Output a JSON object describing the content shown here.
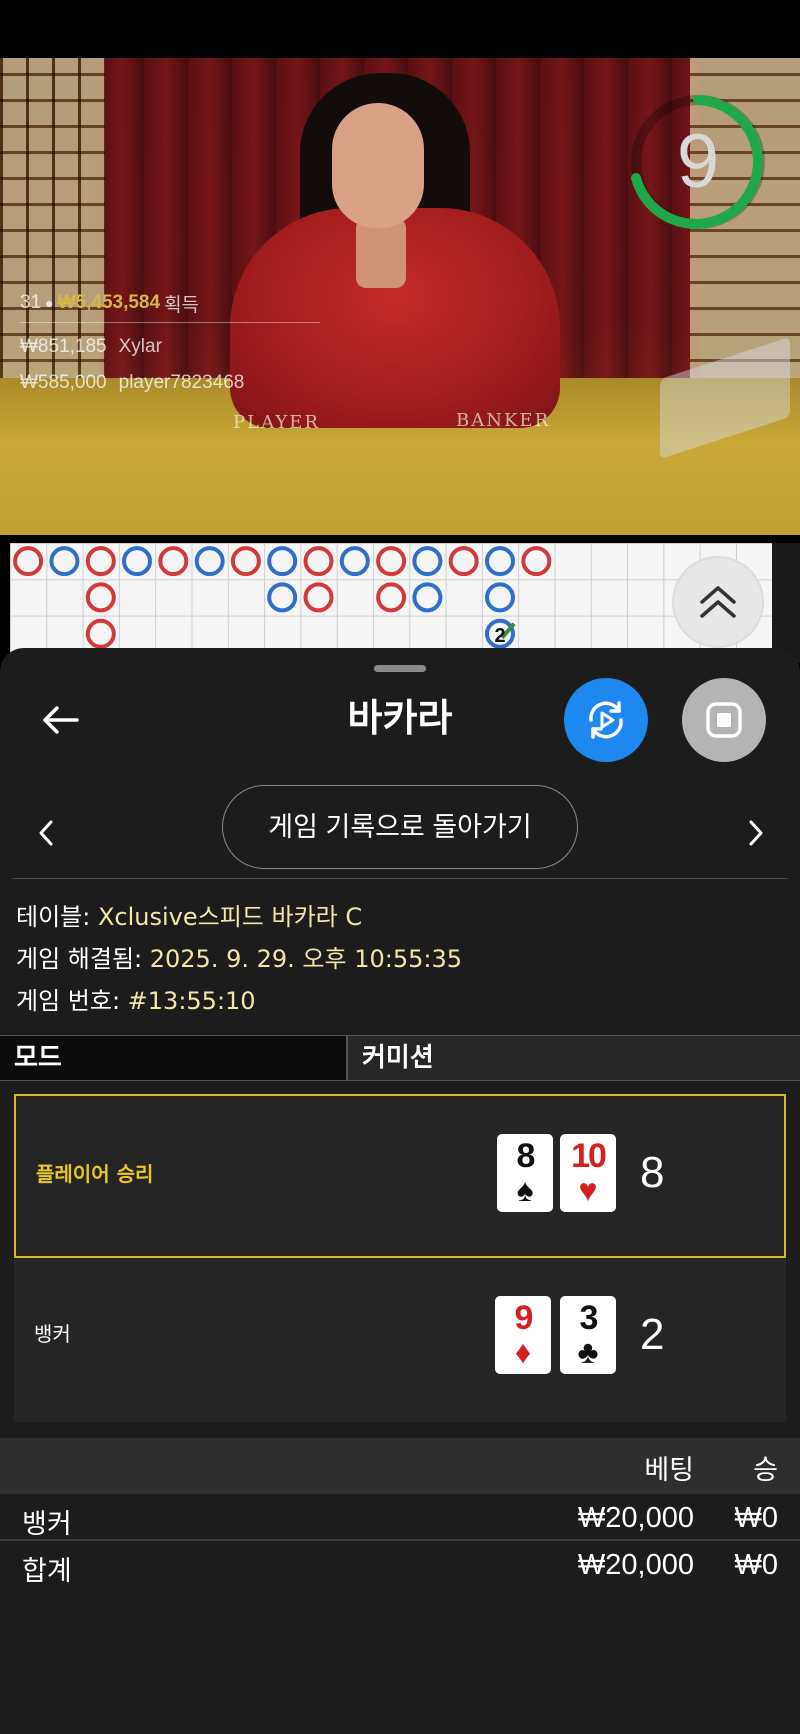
{
  "video": {
    "countdown": "9",
    "felt_player": "PLAYER",
    "felt_banker": "BANKER",
    "winners": {
      "count": "31",
      "total_amount": "₩5,453,584",
      "total_suffix": "획득",
      "list": [
        {
          "amount": "₩851,185",
          "name": "Xylar"
        },
        {
          "amount": "₩585,000",
          "name": "player7823468"
        }
      ]
    }
  },
  "roadmap": {
    "tie_count": "2",
    "colors": {
      "player": "#2f6fc9",
      "banker": "#d23a3a",
      "tie": "#2f8f3f"
    },
    "columns": [
      [
        "banker"
      ],
      [
        "player"
      ],
      [
        "banker",
        "banker",
        "banker"
      ],
      [
        "player"
      ],
      [
        "banker"
      ],
      [
        "player"
      ],
      [
        "banker"
      ],
      [
        "player",
        "player"
      ],
      [
        "banker",
        "banker"
      ],
      [
        "player"
      ],
      [
        "banker",
        "banker"
      ],
      [
        "player",
        "player"
      ],
      [
        "banker"
      ],
      [
        "player",
        "player",
        "player"
      ],
      [
        "banker"
      ]
    ]
  },
  "sheet": {
    "title": "바카라",
    "history_button": "게임 기록으로 돌아가기",
    "info": {
      "table_label": "테이블: ",
      "table_value": "Xclusive스피드 바카라 C",
      "resolved_label": "게임 해결됨: ",
      "resolved_value": "2025. 9. 29. 오후 10:55:35",
      "number_label": "게임 번호: ",
      "number_value": "#13:55:10"
    },
    "tabs": {
      "mode": "모드",
      "commission": "커미션"
    },
    "player_hand": {
      "label": "플레이어 승리",
      "cards": [
        {
          "rank": "8",
          "suit": "♠",
          "color": "black"
        },
        {
          "rank": "10",
          "suit": "♥",
          "color": "red"
        }
      ],
      "score": "8"
    },
    "banker_hand": {
      "label": "뱅커",
      "cards": [
        {
          "rank": "9",
          "suit": "♦",
          "color": "red"
        },
        {
          "rank": "3",
          "suit": "♣",
          "color": "black"
        }
      ],
      "score": "2"
    },
    "bets": {
      "header_bet": "베팅",
      "header_win": "승",
      "rows": [
        {
          "name": "뱅커",
          "amount": "₩20,000",
          "win": "₩0"
        },
        {
          "name": "합계",
          "amount": "₩20,000",
          "win": "₩0"
        }
      ]
    }
  }
}
